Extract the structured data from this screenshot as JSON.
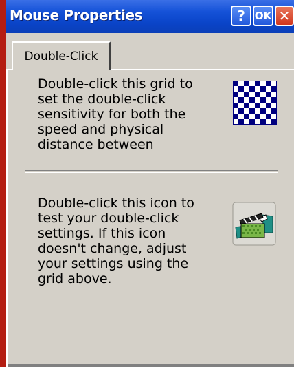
{
  "window": {
    "title": "Mouse Properties",
    "help_label": "?",
    "ok_label": "OK",
    "close_label": "✕"
  },
  "tabs": [
    {
      "label": "Double-Click",
      "selected": true
    }
  ],
  "content": {
    "grid_instruction": "Double-click this grid to\nset the double-click\nsensitivity for both the\nspeed and physical\ndistance between",
    "icon_instruction": "Double-click this icon to\ntest your double-click\nsettings. If this icon\ndoesn't change, adjust\nyour settings using the\ngrid above."
  },
  "icons": {
    "grid": "checkerboard-grid-icon",
    "test": "clapperboard-icon"
  },
  "colors": {
    "titlebar": "#0a44c8",
    "close_button": "#d1371e",
    "frame_edge": "#b41d12",
    "grid_dark": "#00007f"
  }
}
